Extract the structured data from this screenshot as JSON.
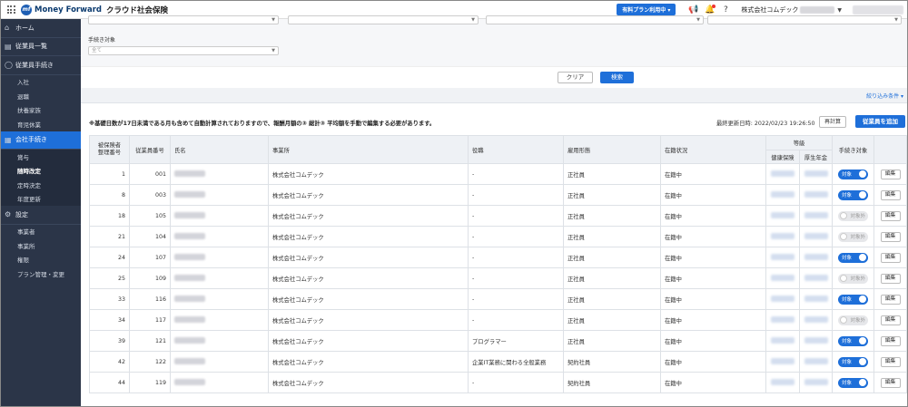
{
  "app": {
    "brand": "Money Forward",
    "product": "クラウド社会保険",
    "plan_badge": "有料プラン利用中 ▾",
    "company": "株式会社コムデック"
  },
  "sidebar": {
    "items": [
      {
        "label": "ホーム",
        "icon": "home-icon"
      },
      {
        "label": "従業員一覧",
        "icon": "people-icon"
      },
      {
        "label": "従業員手続き",
        "icon": "person-icon"
      }
    ],
    "employee_sub": [
      "入社",
      "退職",
      "扶養家族",
      "育児休業"
    ],
    "company_proc": {
      "label": "会社手続き",
      "icon": "building-icon"
    },
    "company_sub": [
      "賞与",
      "随時改定",
      "定時決定",
      "年度更新"
    ],
    "settings": {
      "label": "設定",
      "icon": "gear-icon"
    },
    "settings_sub": [
      "事業者",
      "事業所",
      "権限",
      "プラン管理・変更"
    ]
  },
  "filters": {
    "procedure_label": "手続き対象",
    "procedure_value": "全て",
    "clear_label": "クリア",
    "search_label": "検索",
    "narrow_label": "絞り込み条件 ▾"
  },
  "notice": "※基礎日数が17日未満である月も含めて自動計算されておりますので、報酬月額の③ 総計③ 平均額を手動で編集する必要があります。",
  "updated_at": "最終更新日時: 2022/02/23 19:26:50",
  "recalc_label": "再計算",
  "add_employee_label": "従業員を追加",
  "table": {
    "headers": {
      "insured_no": "被保険者\n整理番号",
      "emp_no": "従業員番号",
      "name": "氏名",
      "office": "事業所",
      "position": "役職",
      "employment": "雇用形態",
      "status": "在籍状況",
      "grade": "等級",
      "health": "健康保険",
      "pension": "厚生年金",
      "target": "手続き対象",
      "edit": ""
    },
    "on_label": "対象",
    "off_label": "対象外",
    "edit_label": "編集",
    "rows": [
      {
        "insured": "1",
        "emp": "001",
        "office": "株式会社コムデック",
        "position": "-",
        "employment": "正社員",
        "status": "在籍中",
        "target": true
      },
      {
        "insured": "8",
        "emp": "003",
        "office": "株式会社コムデック",
        "position": "-",
        "employment": "正社員",
        "status": "在籍中",
        "target": true
      },
      {
        "insured": "18",
        "emp": "105",
        "office": "株式会社コムデック",
        "position": "-",
        "employment": "正社員",
        "status": "在籍中",
        "target": false
      },
      {
        "insured": "21",
        "emp": "104",
        "office": "株式会社コムデック",
        "position": "-",
        "employment": "正社員",
        "status": "在籍中",
        "target": false
      },
      {
        "insured": "24",
        "emp": "107",
        "office": "株式会社コムデック",
        "position": "-",
        "employment": "正社員",
        "status": "在籍中",
        "target": true
      },
      {
        "insured": "25",
        "emp": "109",
        "office": "株式会社コムデック",
        "position": "-",
        "employment": "正社員",
        "status": "在籍中",
        "target": false
      },
      {
        "insured": "33",
        "emp": "116",
        "office": "株式会社コムデック",
        "position": "-",
        "employment": "正社員",
        "status": "在籍中",
        "target": true
      },
      {
        "insured": "34",
        "emp": "117",
        "office": "株式会社コムデック",
        "position": "-",
        "employment": "正社員",
        "status": "在籍中",
        "target": false
      },
      {
        "insured": "39",
        "emp": "121",
        "office": "株式会社コムデック",
        "position": "プログラマー",
        "employment": "正社員",
        "status": "在籍中",
        "target": true
      },
      {
        "insured": "42",
        "emp": "122",
        "office": "株式会社コムデック",
        "position": "企業IT業務に関わる全般業務",
        "employment": "契約社員",
        "status": "在籍中",
        "target": true
      },
      {
        "insured": "44",
        "emp": "119",
        "office": "株式会社コムデック",
        "position": "-",
        "employment": "契約社員",
        "status": "在籍中",
        "target": true
      }
    ]
  },
  "colors": {
    "accent": "#1e6fd9",
    "sidebar": "#2b3548"
  }
}
